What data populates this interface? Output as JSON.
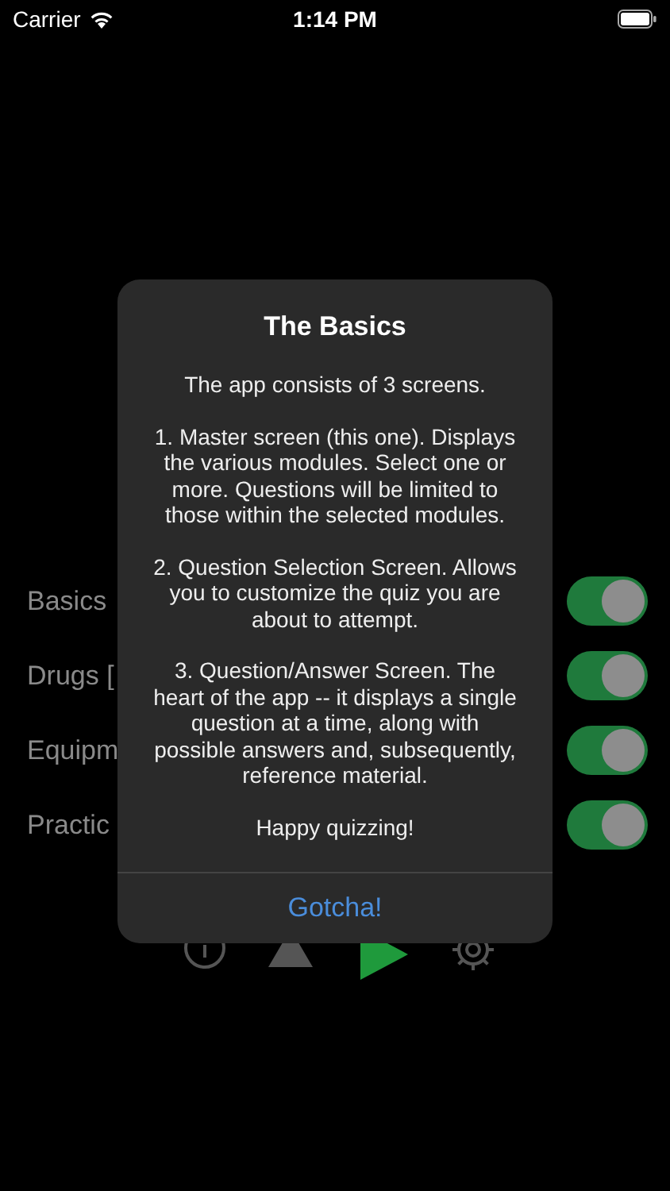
{
  "status_bar": {
    "carrier": "Carrier",
    "time": "1:14 PM"
  },
  "modules": [
    {
      "label": "Basics",
      "on": true
    },
    {
      "label": "Drugs [",
      "on": true
    },
    {
      "label": "Equipm",
      "on": true
    },
    {
      "label": "Practic",
      "on": true
    }
  ],
  "toolbar": [
    {
      "kind": "info"
    },
    {
      "kind": "triangle"
    },
    {
      "kind": "play"
    },
    {
      "kind": "settings"
    }
  ],
  "alert": {
    "title": "The Basics",
    "paragraphs": [
      "The app consists of 3 screens.",
      "1. Master screen (this one). Displays the various modules. Select one or more. Questions will be limited to those within the selected modules.",
      "2. Question Selection Screen. Allows you to customize the quiz you are about to attempt.",
      "3. Question/Answer Screen. The heart of the app -- it displays a single question at a time, along with possible answers and, subsequently, reference material.",
      "Happy quizzing!"
    ],
    "button": "Gotcha!"
  }
}
